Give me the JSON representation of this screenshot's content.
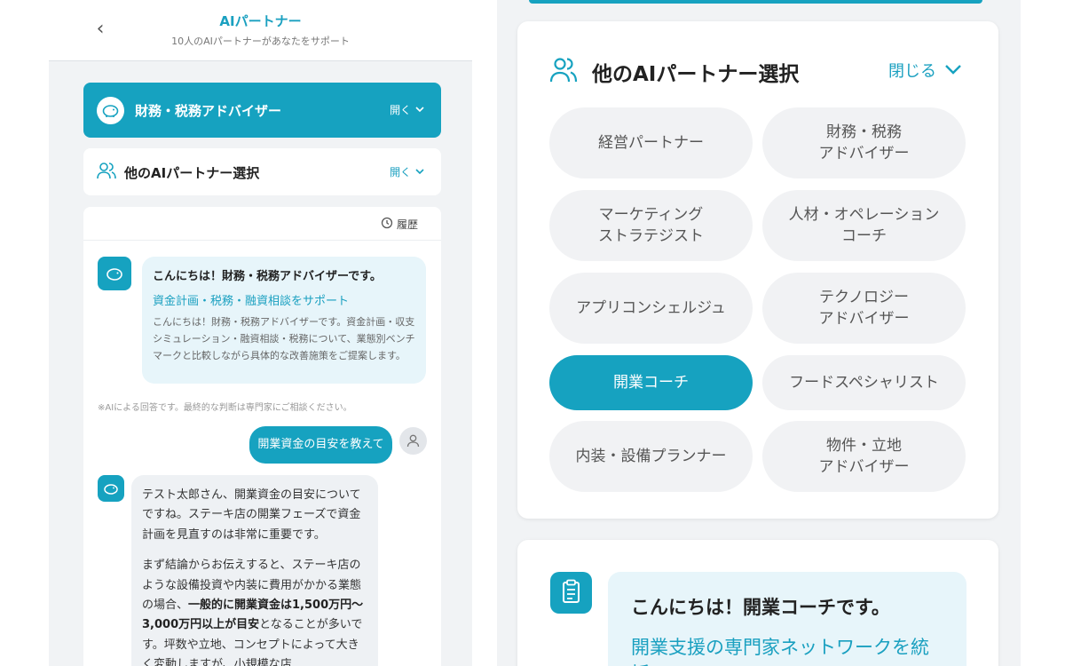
{
  "left": {
    "header": {
      "title": "AIパートナー",
      "subtitle": "10人のAIパートナーがあなたをサポート"
    },
    "selected_partner": {
      "name": "財務・税務アドバイザー",
      "toggle_label": "開く"
    },
    "other_partners": {
      "label": "他のAIパートナー選択",
      "toggle_label": "開く"
    },
    "chat": {
      "history_label": "履歴",
      "greeting": {
        "title": "こんにちは！財務・税務アドバイザーです。",
        "subtitle": "資金計画・税務・融資相談をサポート",
        "body": "こんにちは！財務・税務アドバイザーです。資金計画・収支シミュレーション・融資相談・税務について、業態別ベンチマークと比較しながら具体的な改善施策をご提案します。"
      },
      "disclaimer": "※AIによる回答です。最終的な判断は専門家にご相談ください。",
      "user_message": "開業資金の目安を教えて",
      "reply": {
        "p1": "テスト太郎さん、開業資金の目安についてですね。ステーキ店の開業フェーズで資金計画を見直すのは非常に重要です。",
        "p2_a": "まず結論からお伝えすると、ステーキ店のような設備投資や内装に費用がかかる業態の場合、",
        "p2_b": "一般的に開業資金は1,500万円〜3,000万円以上が目安",
        "p2_c": "となることが多いです。坪数や立地、コンセプトによって大きく変動しますが、小規模な店"
      }
    }
  },
  "right": {
    "picker": {
      "title": "他のAIパートナー選択",
      "close_label": "閉じる",
      "partners": [
        "経営パートナー",
        "財務・税務\nアドバイザー",
        "マーケティング\nストラテジスト",
        "人材・オペレーション\nコーチ",
        "アプリコンシェルジュ",
        "テクノロジー\nアドバイザー",
        "開業コーチ",
        "フードスペシャリスト",
        "内装・設備プランナー",
        "物件・立地\nアドバイザー"
      ],
      "active_partner": "開業コーチ"
    },
    "coach_card": {
      "title": "こんにちは！開業コーチです。",
      "subtitle": "開業支援の専門家ネットワークを統括"
    }
  },
  "colors": {
    "accent": "#16a2c0",
    "bubble_bg": "#e7f5fa",
    "panel_bg": "#f1f3f5",
    "chip_bg": "#f1f2f4"
  }
}
